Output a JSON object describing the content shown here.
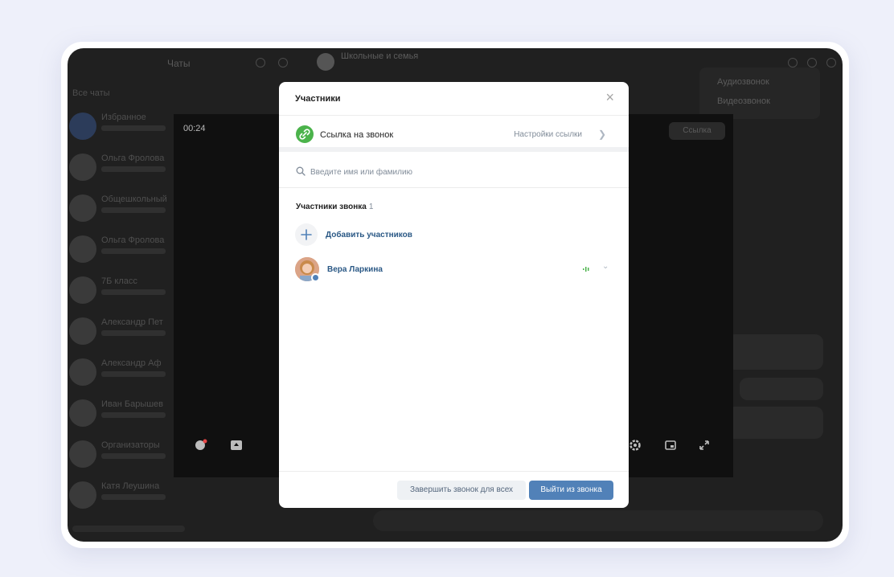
{
  "app": {
    "title": "Чаты",
    "chats_caption": "Все чаты",
    "current_chat": "Школьные и семья",
    "chats": [
      {
        "name": "Избранное"
      },
      {
        "name": "Ольга Фролова"
      },
      {
        "name": "Общешкольный"
      },
      {
        "name": "Ольга Фролова"
      },
      {
        "name": "7Б класс"
      },
      {
        "name": "Александр Пет"
      },
      {
        "name": "Александр Аф"
      },
      {
        "name": "Иван Барышев"
      },
      {
        "name": "Организаторы"
      },
      {
        "name": "Катя Леушина"
      }
    ],
    "menu": {
      "audio_call": "Аудиозвонок",
      "video_call": "Видеозвонок"
    }
  },
  "call": {
    "timer": "00:24",
    "link_chip": "Ссылка"
  },
  "modal": {
    "title": "Участники",
    "link_row": {
      "label": "Ссылка на звонок",
      "settings": "Настройки ссылки"
    },
    "search": {
      "placeholder": "Введите имя или фамилию",
      "value": ""
    },
    "section": {
      "title": "Участники звонка",
      "count": "1"
    },
    "add_label": "Добавить участников",
    "members": [
      {
        "name": "Вера Ларкина"
      }
    ],
    "footer": {
      "end_for_all": "Завершить звонок для всех",
      "leave": "Выйти из звонка"
    }
  },
  "colors": {
    "accent": "#5181b8",
    "link_text": "#2a5885",
    "success": "#4bb34b",
    "page_bg": "#eef0fa"
  }
}
